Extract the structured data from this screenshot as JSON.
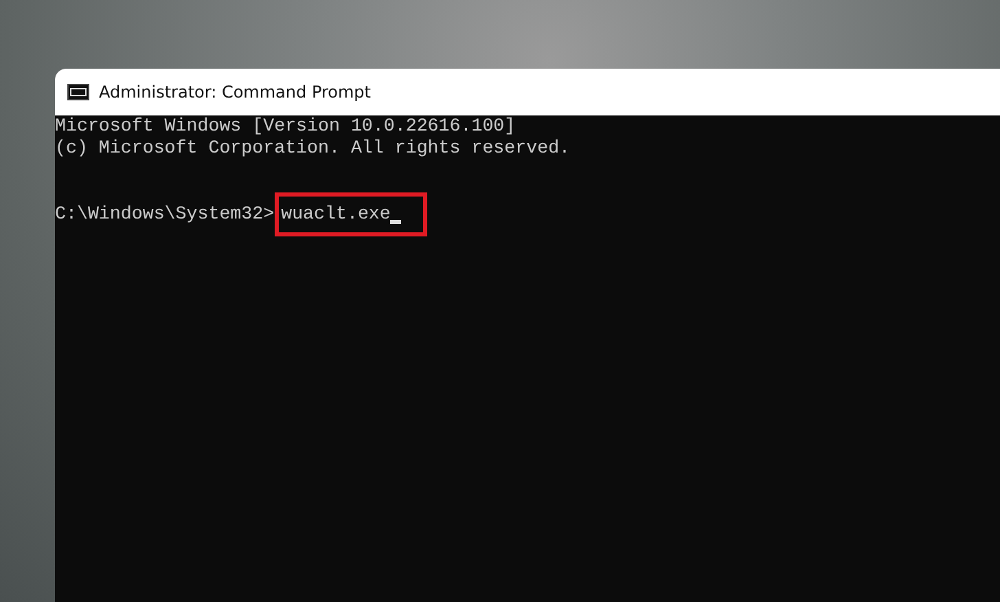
{
  "window": {
    "title": "Administrator: Command Prompt"
  },
  "console": {
    "lines": [
      "Microsoft Windows [Version 10.0.22616.100]",
      "(c) Microsoft Corporation. All rights reserved."
    ],
    "prompt": "C:\\Windows\\System32>",
    "command": "wuaclt.exe",
    "command_highlighted": true
  }
}
